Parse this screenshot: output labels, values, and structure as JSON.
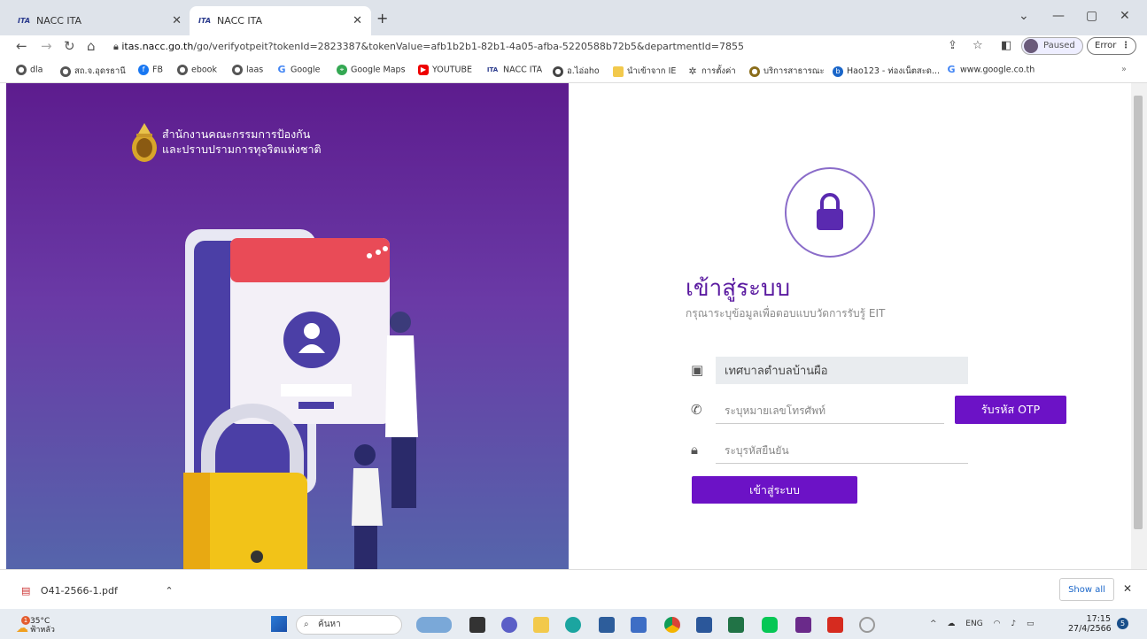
{
  "browser": {
    "tabs": [
      {
        "label": "NACC ITA",
        "favicon": "ITA"
      },
      {
        "label": "NACC ITA",
        "favicon": "ITA"
      }
    ],
    "url_domain": "itas.nacc.go.th",
    "url_path": "/go/verifyotpeit?tokenId=2823387&tokenValue=afb1b2b1-82b1-4a05-afba-5220588b72b5&departmentId=7855",
    "profile_label": "Paused",
    "error_label": "Error",
    "bookmarks": [
      "dla",
      "สถ.จ.อุดรธานี",
      "FB",
      "ebook",
      "laas",
      "Google",
      "Google Maps",
      "YOUTUBE",
      "NACC ITA",
      "อ.ไอ่อho",
      "นำเข้าจาก IE",
      "การตั้งค่า",
      "บริการสาธารณะ",
      "Hao123 - ท่องเน็ตสะด...",
      "www.google.co.th"
    ]
  },
  "brand": {
    "line1": "สำนักงานคณะกรรมการป้องกัน",
    "line2": "และปราบปรามการทุจริตแห่งชาติ"
  },
  "login": {
    "title": "เข้าสู่ระบบ",
    "subtitle": "กรุณาระบุข้อมูลเพื่อตอบแบบวัดการรับรู้ EIT",
    "organization_value": "เทศบาลตำบลบ้านผือ",
    "phone_placeholder": "ระบุหมายเลขโทรศัพท์",
    "otp_button": "รับรหัส OTP",
    "code_placeholder": "ระบุรหัสยืนยัน",
    "submit_button": "เข้าสู่ระบบ"
  },
  "downloads": {
    "file": "O41-2566-1.pdf",
    "show_all": "Show all"
  },
  "taskbar": {
    "temp": "35°C",
    "weather": "ฟ้าหลัว",
    "search": "ค้นหา",
    "lang": "ENG",
    "time": "17:15",
    "date": "27/4/2566",
    "notifications": "5",
    "weather_badge": "1"
  },
  "colors": {
    "accent": "#6c12c6",
    "panel_top": "#5d1c8e",
    "panel_bottom": "#5565ab"
  }
}
